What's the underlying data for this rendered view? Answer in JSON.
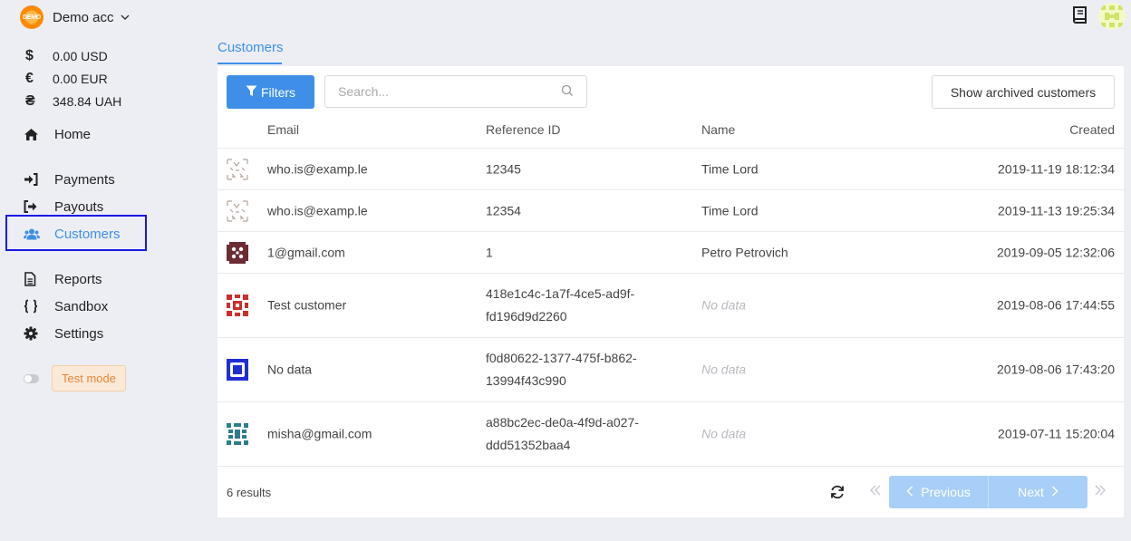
{
  "account": {
    "logo_text": "DEMO",
    "name": "Demo acc"
  },
  "balances": [
    {
      "symbol": "$",
      "amount": "0.00 USD"
    },
    {
      "symbol": "€",
      "amount": "0.00 EUR"
    },
    {
      "symbol": "₴",
      "amount": "348.84 UAH"
    }
  ],
  "nav": {
    "home": "Home",
    "payments": "Payments",
    "payouts": "Payouts",
    "customers": "Customers",
    "reports": "Reports",
    "sandbox": "Sandbox",
    "settings": "Settings"
  },
  "test_mode_label": "Test mode",
  "tab": "Customers",
  "toolbar": {
    "filters_label": "Filters",
    "search_placeholder": "Search...",
    "archived_label": "Show archived customers"
  },
  "table": {
    "headers": {
      "email": "Email",
      "reference": "Reference ID",
      "name": "Name",
      "created": "Created"
    },
    "rows": [
      {
        "email": "who.is@examp.le",
        "ref1": "12345",
        "ref2": "",
        "name": "Time Lord",
        "created": "2019-11-19 18:12:34"
      },
      {
        "email": "who.is@examp.le",
        "ref1": "12354",
        "ref2": "",
        "name": "Time Lord",
        "created": "2019-11-13 19:25:34"
      },
      {
        "email": "1@gmail.com",
        "ref1": "1",
        "ref2": "",
        "name": "Petro Petrovich",
        "created": "2019-09-05 12:32:06"
      },
      {
        "email": "Test customer",
        "ref1": "418e1c4c-1a7f-4ce5-ad9f-",
        "ref2": "fd196d9d2260",
        "name": "No data",
        "created": "2019-08-06 17:44:55"
      },
      {
        "email": "No data",
        "ref1": "f0d80622-1377-475f-b862-",
        "ref2": "13994f43c990",
        "name": "No data",
        "created": "2019-08-06 17:43:20"
      },
      {
        "email": "misha@gmail.com",
        "ref1": "a88bc2ec-de0a-4f9d-a027-",
        "ref2": "ddd51352baa4",
        "name": "No data",
        "created": "2019-07-11 15:20:04"
      }
    ]
  },
  "footer": {
    "results": "6 results",
    "previous": "Previous",
    "next": "Next"
  },
  "colors": {
    "accent": "#3f8fe8",
    "highlight_box": "#1a16e6",
    "pager_disabled": "#a8cff7"
  }
}
